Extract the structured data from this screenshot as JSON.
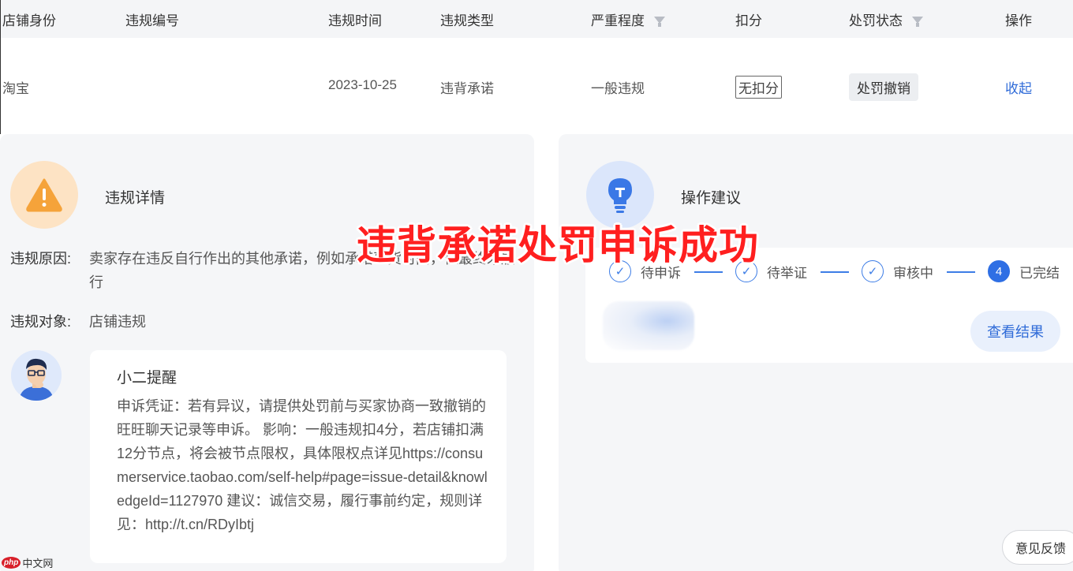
{
  "table": {
    "headers": [
      "店铺身份",
      "违规编号",
      "违规时间",
      "违规类型",
      "严重程度",
      "扣分",
      "处罚状态",
      "操作"
    ],
    "row": {
      "shop_identity": "淘宝",
      "violation_id": "",
      "violation_time": "2023-10-25",
      "violation_type": "违背承诺",
      "severity": "一般违规",
      "deduction": "无扣分",
      "penalty_status": "处罚撤销",
      "action": "收起"
    }
  },
  "detail": {
    "title": "违规详情",
    "reason_label": "违规原因:",
    "reason_value": "卖家存在违反自行作出的其他承诺，例如承诺到货时间，但最终未履行",
    "target_label": "违规对象:",
    "target_value": "店铺违规",
    "reminder": {
      "title": "小二提醒",
      "body": "申诉凭证：若有异议，请提供处罚前与买家协商一致撤销的旺旺聊天记录等申诉。 影响：一般违规扣4分，若店铺扣满12分节点，将会被节点限权，具体限权点详见https://consumerservice.taobao.com/self-help#page=issue-detail&knowledgeId=1127970 建议：诚信交易，履行事前约定，规则详见：http://t.cn/RDyIbtj"
    }
  },
  "advice": {
    "title": "操作建议",
    "steps": [
      {
        "label": "待申诉",
        "state": "done"
      },
      {
        "label": "待举证",
        "state": "done"
      },
      {
        "label": "审核中",
        "state": "done"
      },
      {
        "label": "已完结",
        "state": "current",
        "number": "4"
      }
    ],
    "result_button": "查看结果"
  },
  "overlay_text": "违背承诺处罚申诉成功",
  "feedback_button": "意见反馈",
  "watermark": {
    "badge": "php",
    "text": "中文网"
  },
  "colors": {
    "link": "#2f6bd8",
    "overlay": "#ff1f1f",
    "step": "#3d7de6",
    "warning": "#f5a33a"
  }
}
